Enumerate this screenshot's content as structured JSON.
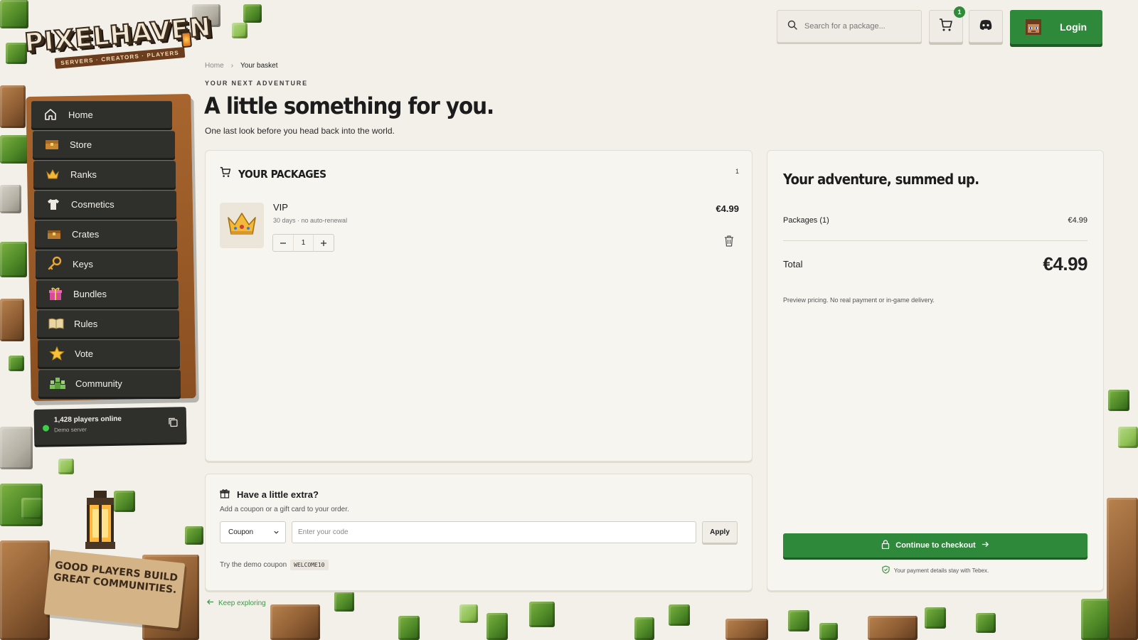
{
  "brand": {
    "logo_text": "PIXELHAVEN",
    "logo_tagline": "SERVERS · CREATORS · PLAYERS"
  },
  "nav": {
    "items": [
      {
        "label": "Home",
        "icon": "home-icon"
      },
      {
        "label": "Store",
        "icon": "chest-icon"
      },
      {
        "label": "Ranks",
        "icon": "crown-icon"
      },
      {
        "label": "Cosmetics",
        "icon": "shirt-icon"
      },
      {
        "label": "Crates",
        "icon": "crate-icon"
      },
      {
        "label": "Keys",
        "icon": "key-icon"
      },
      {
        "label": "Bundles",
        "icon": "gift-icon"
      },
      {
        "label": "Rules",
        "icon": "book-icon"
      },
      {
        "label": "Vote",
        "icon": "star-icon"
      },
      {
        "label": "Community",
        "icon": "people-icon"
      }
    ]
  },
  "server_status": {
    "players": "1,428 players online",
    "server": "Demo server",
    "status_color": "#3ecf4a"
  },
  "sign_text": "GOOD PLAYERS BUILD GREAT COMMUNITIES.",
  "topbar": {
    "search_placeholder": "Search for a package...",
    "cart_count": "1",
    "login_label": "Login"
  },
  "breadcrumb": {
    "home": "Home",
    "separator": "›",
    "current": "Your basket"
  },
  "header": {
    "eyebrow": "YOUR NEXT ADVENTURE",
    "title": "A little something for you.",
    "subtitle": "One last look before you head back into the world."
  },
  "packages": {
    "title": "YOUR PACKAGES",
    "count": "1",
    "items": [
      {
        "name": "VIP",
        "meta": "30 days · no auto-renewal",
        "price": "€4.99",
        "quantity": "1",
        "icon": "crown-icon"
      }
    ]
  },
  "extras": {
    "title": "Have a little extra?",
    "subtitle": "Add a coupon or a gift card to your order.",
    "select_value": "Coupon",
    "code_placeholder": "Enter your code",
    "apply_label": "Apply",
    "hint": "Try the demo coupon",
    "demo_code": "WELCOME10",
    "keep_link": "Keep exploring"
  },
  "summary": {
    "title": "Your adventure, summed up.",
    "packages_label": "Packages (1)",
    "packages_value": "€4.99",
    "total_label": "Total",
    "total_value": "€4.99",
    "note": "Preview pricing. No real payment or in-game delivery.",
    "checkout_label": "Continue to checkout",
    "secure_note": "Your payment details stay with Tebex."
  },
  "colors": {
    "accent": "#2e8a3a",
    "background": "#f3f0e9",
    "nav_bg": "#2f302c"
  }
}
